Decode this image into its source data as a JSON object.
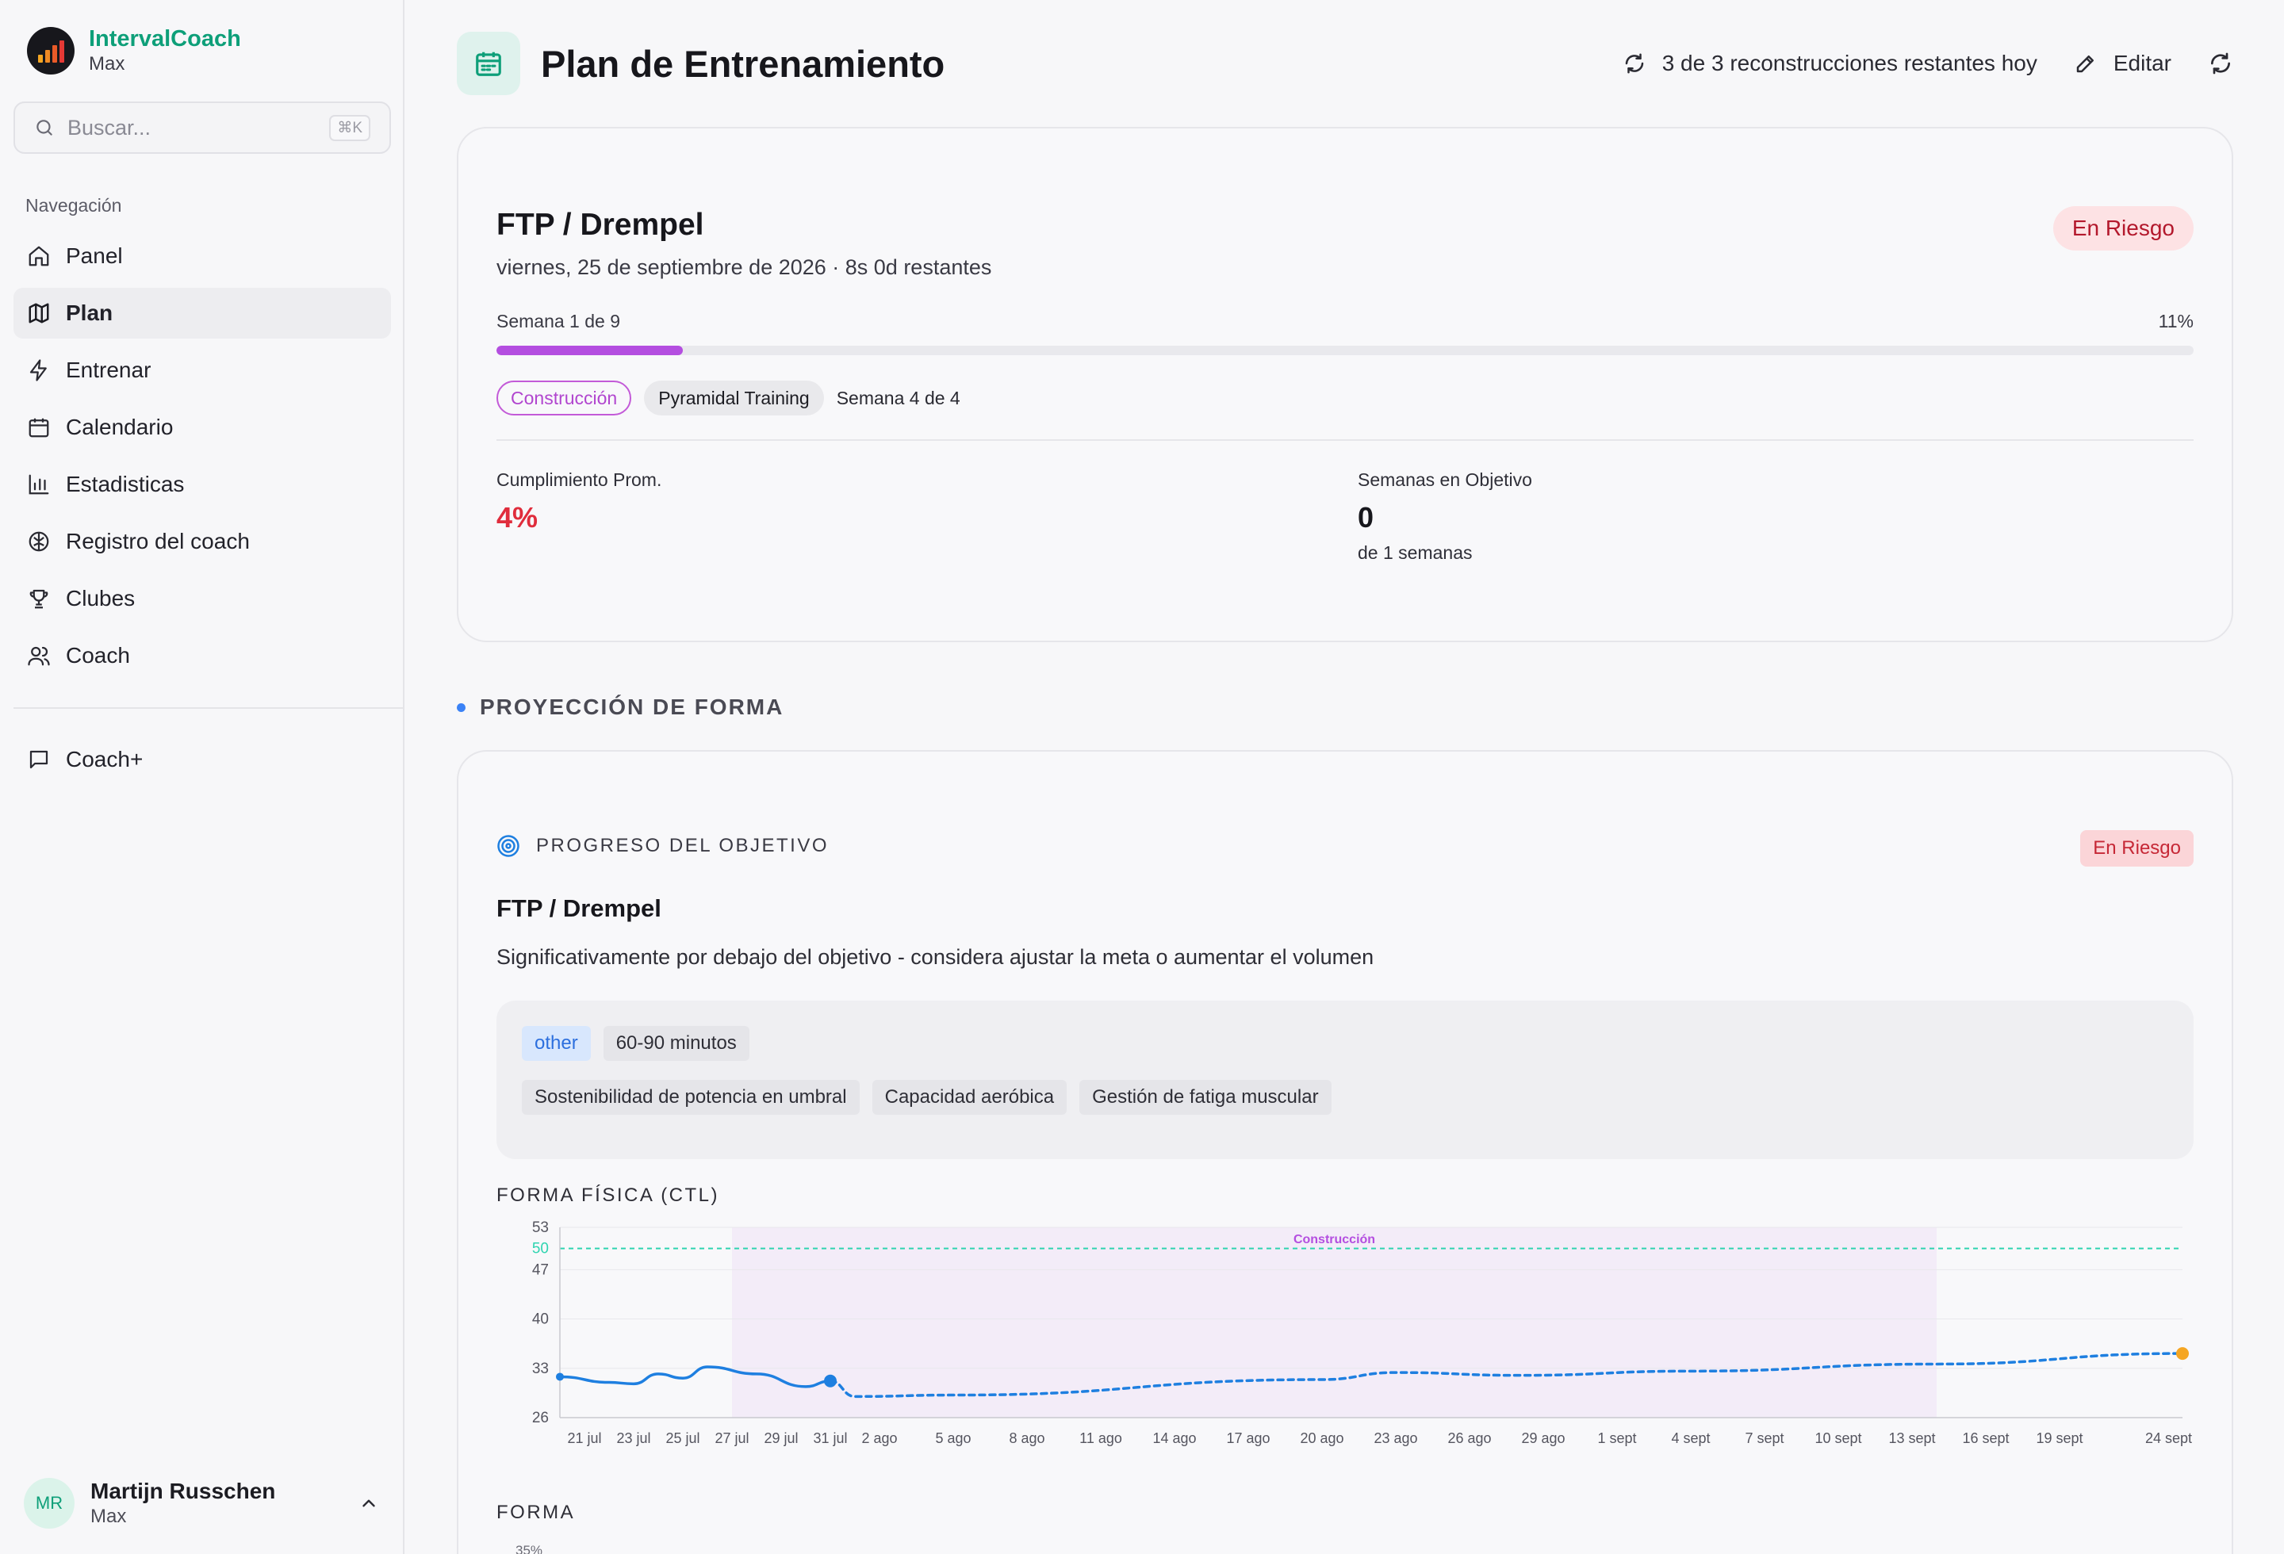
{
  "app": {
    "name": "IntervalCoach",
    "subtitle": "Max"
  },
  "search": {
    "placeholder": "Buscar...",
    "shortcut": "⌘K"
  },
  "nav": {
    "title": "Navegación",
    "items": [
      {
        "label": "Panel",
        "icon": "home-icon"
      },
      {
        "label": "Plan",
        "icon": "map-icon",
        "active": true
      },
      {
        "label": "Entrenar",
        "icon": "lightning-icon"
      },
      {
        "label": "Calendario",
        "icon": "calendar-icon"
      },
      {
        "label": "Estadisticas",
        "icon": "bar-chart-icon"
      },
      {
        "label": "Registro del coach",
        "icon": "brain-icon"
      },
      {
        "label": "Clubes",
        "icon": "trophy-icon"
      },
      {
        "label": "Coach",
        "icon": "users-icon"
      }
    ],
    "secondary": [
      {
        "label": "Coach+",
        "icon": "chat-icon"
      }
    ]
  },
  "user": {
    "initials": "MR",
    "name": "Martijn Russchen",
    "subtitle": "Max"
  },
  "header": {
    "title": "Plan de Entrenamiento",
    "rebuilds": "3 de 3 reconstrucciones restantes hoy",
    "edit": "Editar"
  },
  "goal": {
    "title": "FTP / Drempel",
    "date": "viernes, 25 de septiembre de 2026 · 8s 0d restantes",
    "status": "En Riesgo",
    "week_label": "Semana 1 de 9",
    "progress_label": "11%",
    "progress": 0.11,
    "phase": "Construcción",
    "block": "Pyramidal Training",
    "block_week": "Semana 4 de 4",
    "stats": {
      "compliance_label": "Cumplimiento Prom.",
      "compliance_value": "4%",
      "weeks_label": "Semanas en Objetivo",
      "weeks_value": "0",
      "weeks_sub": "de 1 semanas"
    }
  },
  "projection": {
    "section_title": "PROYECCIÓN DE FORMA",
    "objective_label": "PROGRESO DEL OBJETIVO",
    "status": "En Riesgo",
    "title": "FTP / Drempel",
    "description": "Significativamente por debajo del objetivo - considera ajustar la meta o aumentar el volumen",
    "tags_row1": [
      "other",
      "60-90 minutos"
    ],
    "tags_row2": [
      "Sostenibilidad de potencia en umbral",
      "Capacidad aeróbica",
      "Gestión de fatiga muscular"
    ],
    "ctl_label": "FORMA FÍSICA (CTL)",
    "forma_label": "FORMA",
    "forma_first_tick": "35%"
  },
  "colors": {
    "accent": "#0e9f79",
    "phase": "#b44ee0",
    "risk": "#c62836",
    "actual": "#1e7fe0",
    "target": "#2fd4b0",
    "end": "#f5a623"
  },
  "chart_data": {
    "type": "line",
    "title": "FORMA FÍSICA (CTL)",
    "x_ticks": [
      "21 jul",
      "23 jul",
      "25 jul",
      "27 jul",
      "29 jul",
      "31 jul",
      "2 ago",
      "5 ago",
      "8 ago",
      "11 ago",
      "14 ago",
      "17 ago",
      "20 ago",
      "23 ago",
      "26 ago",
      "29 ago",
      "1 sept",
      "4 sept",
      "7 sept",
      "10 sept",
      "13 sept",
      "16 sept",
      "19 sept",
      "24 sept"
    ],
    "y_ticks": [
      26,
      33,
      40,
      47,
      53
    ],
    "ylim": [
      26,
      53
    ],
    "target": {
      "value": 50,
      "label": "50"
    },
    "phase_band": {
      "label": "Construcción",
      "start": "27 jul",
      "end": "14 sept"
    },
    "series": [
      {
        "style": "solid",
        "points": [
          {
            "x": "20 jul",
            "y": 31.8
          },
          {
            "x": "22 jul",
            "y": 31.0
          },
          {
            "x": "23 jul",
            "y": 30.8
          },
          {
            "x": "24 jul",
            "y": 32.2
          },
          {
            "x": "25 jul",
            "y": 31.6
          },
          {
            "x": "26 jul",
            "y": 33.2
          },
          {
            "x": "28 jul",
            "y": 32.2
          },
          {
            "x": "30 jul",
            "y": 30.4
          },
          {
            "x": "31 jul",
            "y": 31.2
          }
        ]
      },
      {
        "style": "dashed",
        "points": [
          {
            "x": "31 jul",
            "y": 31.2
          },
          {
            "x": "1 ago",
            "y": 29.0
          },
          {
            "x": "5 ago",
            "y": 29.2
          },
          {
            "x": "20 ago",
            "y": 31.4
          },
          {
            "x": "23 ago",
            "y": 32.4
          },
          {
            "x": "28 ago",
            "y": 32.0
          },
          {
            "x": "4 sept",
            "y": 32.6
          },
          {
            "x": "14 sept",
            "y": 33.6
          },
          {
            "x": "24 sept",
            "y": 35.1
          }
        ]
      }
    ]
  }
}
